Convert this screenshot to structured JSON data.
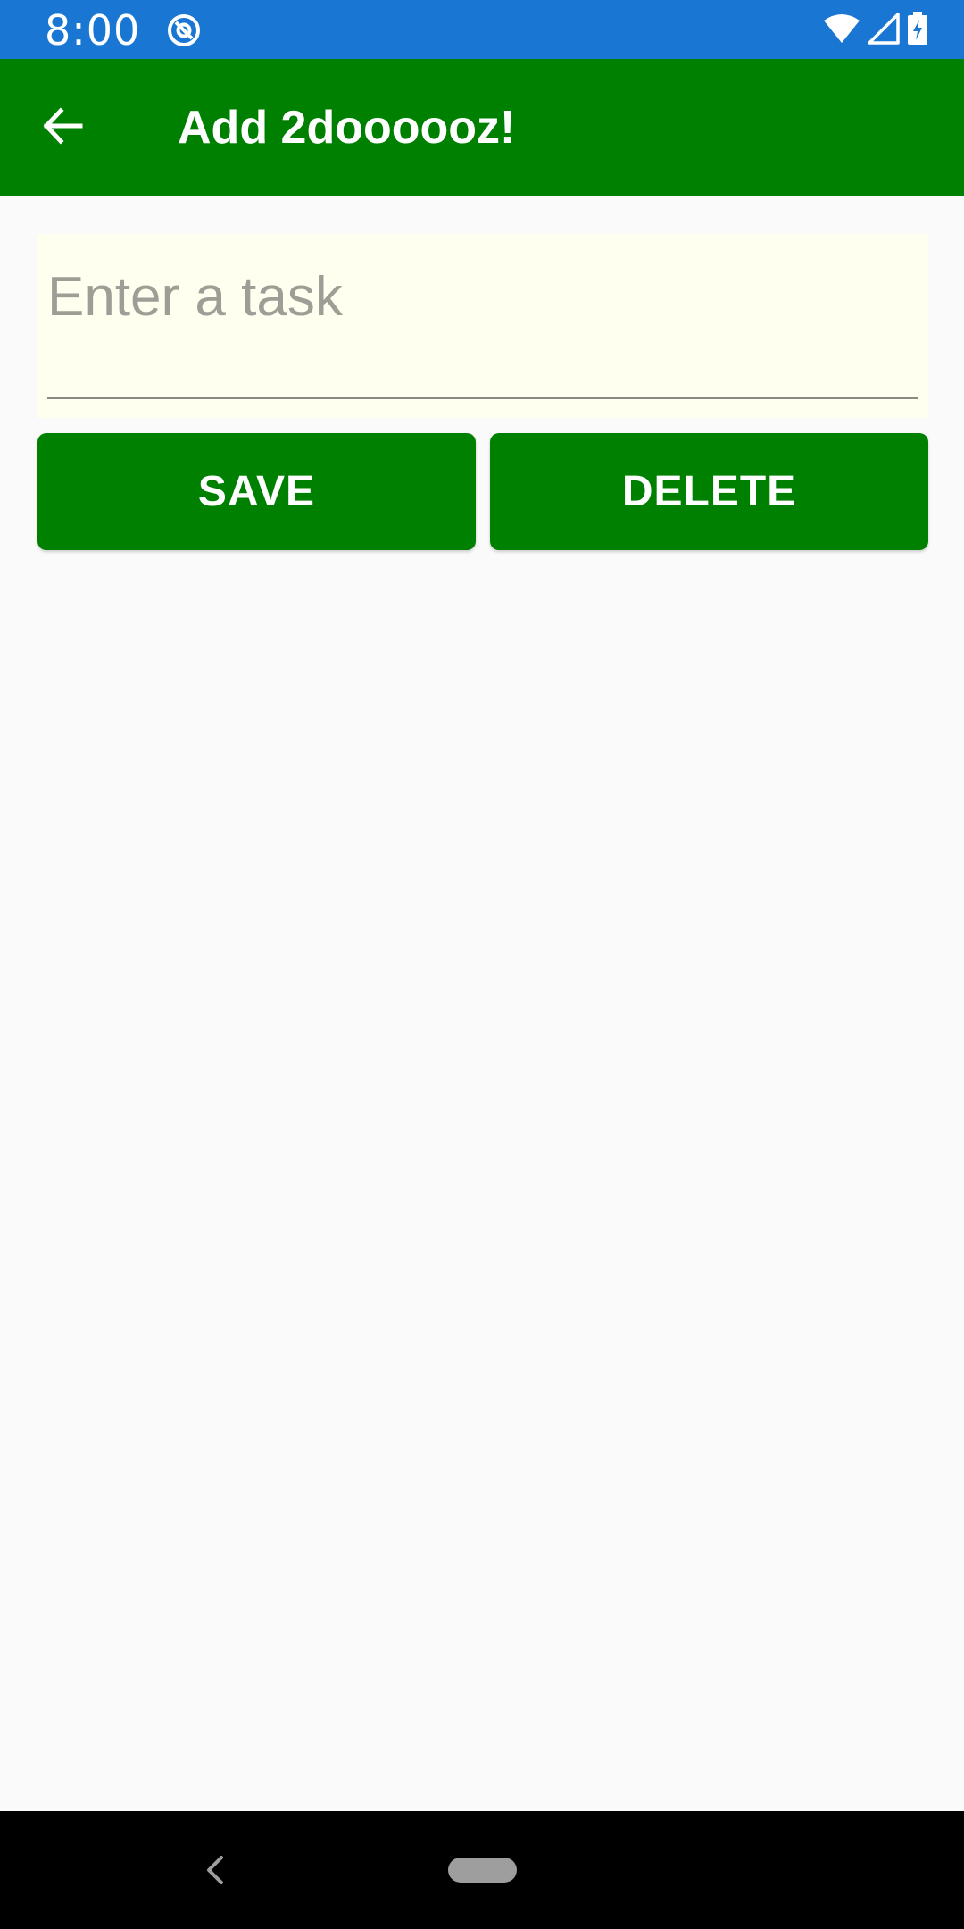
{
  "status_bar": {
    "time": "8:00",
    "app_icon": "at-sign-icon",
    "icons": [
      "wifi-icon",
      "signal-icon",
      "battery-charging-icon"
    ],
    "color": "#1976D2"
  },
  "app_bar": {
    "back_icon": "arrow-left-icon",
    "title": "Add 2doooooz!",
    "color": "#008000"
  },
  "task_form": {
    "input_value": "",
    "input_placeholder": "Enter a task",
    "input_background": "#FFFFF0"
  },
  "actions": {
    "save_label": "SAVE",
    "delete_label": "DELETE",
    "button_color": "#008000"
  },
  "nav_bar": {
    "back_icon": "chevron-left-icon",
    "home_icon": "home-pill-icon"
  }
}
